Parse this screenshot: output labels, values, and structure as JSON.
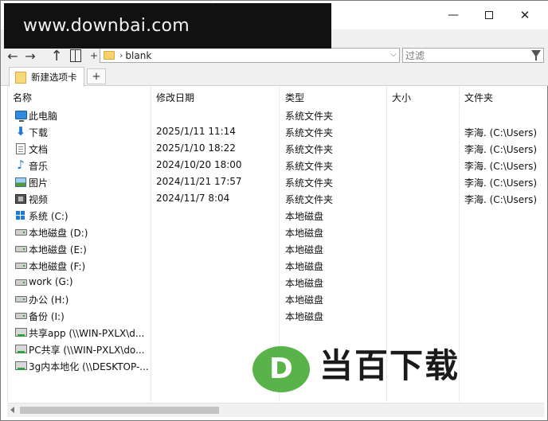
{
  "watermark": {
    "text": "www.downbai.com"
  },
  "window_controls": {
    "minimize": "—",
    "close": "✕"
  },
  "nav": {
    "back": "←",
    "forward": "→",
    "up": "↑",
    "plus": "+",
    "address_chevron": "›",
    "address_text": "blank",
    "address_dropdown": "⌵",
    "filter_placeholder": "过滤"
  },
  "tabs": [
    {
      "label": "新建选项卡"
    }
  ],
  "new_tab_label": "+",
  "columns": {
    "name": "名称",
    "date": "修改日期",
    "type": "类型",
    "size": "大小",
    "folder": "文件夹"
  },
  "rows": [
    {
      "icon": "pc-icon",
      "name": "此电脑",
      "date": "",
      "type": "系统文件夹",
      "size": "",
      "folder": ""
    },
    {
      "icon": "download-icon",
      "name": "下载",
      "date": "2025/1/11 11:14",
      "type": "系统文件夹",
      "size": "",
      "folder": "李海.    (C:\\Users)"
    },
    {
      "icon": "document-icon",
      "name": "文档",
      "date": "2025/1/10 18:22",
      "type": "系统文件夹",
      "size": "",
      "folder": "李海.    (C:\\Users)"
    },
    {
      "icon": "music-icon",
      "name": "音乐",
      "date": "2024/10/20 18:00",
      "type": "系统文件夹",
      "size": "",
      "folder": "李海.    (C:\\Users)"
    },
    {
      "icon": "picture-icon",
      "name": "图片",
      "date": "2024/11/21 17:57",
      "type": "系统文件夹",
      "size": "",
      "folder": "李海.    (C:\\Users)"
    },
    {
      "icon": "video-icon",
      "name": "视频",
      "date": "2024/11/7 8:04",
      "type": "系统文件夹",
      "size": "",
      "folder": "李海.    (C:\\Users)"
    },
    {
      "icon": "windows-drive-icon",
      "name": "系统 (C:)",
      "date": "",
      "type": "本地磁盘",
      "size": "",
      "folder": ""
    },
    {
      "icon": "drive-icon",
      "name": "本地磁盘 (D:)",
      "date": "",
      "type": "本地磁盘",
      "size": "",
      "folder": ""
    },
    {
      "icon": "drive-icon",
      "name": "本地磁盘 (E:)",
      "date": "",
      "type": "本地磁盘",
      "size": "",
      "folder": ""
    },
    {
      "icon": "drive-icon",
      "name": "本地磁盘 (F:)",
      "date": "",
      "type": "本地磁盘",
      "size": "",
      "folder": ""
    },
    {
      "icon": "drive-icon",
      "name": "work (G:)",
      "date": "",
      "type": "本地磁盘",
      "size": "",
      "folder": ""
    },
    {
      "icon": "drive-icon",
      "name": "办公 (H:)",
      "date": "",
      "type": "本地磁盘",
      "size": "",
      "folder": ""
    },
    {
      "icon": "drive-icon",
      "name": "备份 (I:)",
      "date": "",
      "type": "本地磁盘",
      "size": "",
      "folder": ""
    },
    {
      "icon": "network-drive-icon",
      "name": "共享app (\\\\WIN-PXLX\\d...",
      "date": "",
      "type": "",
      "size": "",
      "folder": ""
    },
    {
      "icon": "network-drive-icon",
      "name": "PC共享 (\\\\WIN-PXLX\\do...",
      "date": "",
      "type": "",
      "size": "",
      "folder": ""
    },
    {
      "icon": "network-drive-icon",
      "name": "3g内本地化 (\\\\DESKTOP-...",
      "date": "",
      "type": "",
      "size": "",
      "folder": ""
    }
  ],
  "logo": {
    "mark": "D",
    "text": "当百下载"
  }
}
